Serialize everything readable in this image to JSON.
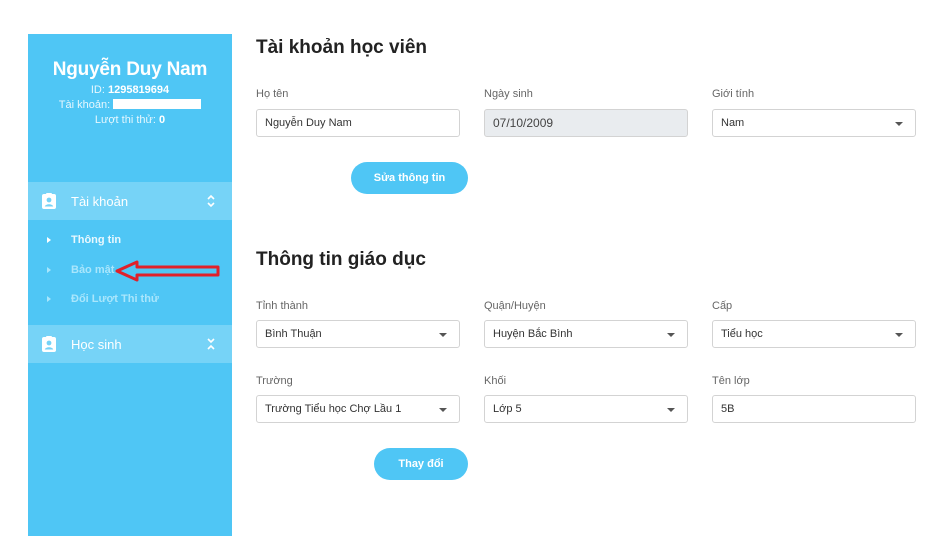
{
  "profile": {
    "name": "Nguyễn Duy Nam",
    "id_label": "ID:",
    "id_value": "1295819694",
    "account_label": "Tài khoản:",
    "attempts_label": "Lượt thi thử:",
    "attempts_value": "0"
  },
  "sidebar": {
    "account_menu": {
      "label": "Tài khoản",
      "icon": "user-badge-icon",
      "items": [
        {
          "label": "Thông tin"
        },
        {
          "label": "Bảo mật"
        },
        {
          "label": "Đổi Lượt Thi thử"
        }
      ]
    },
    "student_menu": {
      "label": "Học sinh",
      "icon": "user-badge-icon"
    }
  },
  "account_section": {
    "title": "Tài khoản học viên",
    "fullname": {
      "label": "Họ tên",
      "value": "Nguyễn Duy Nam"
    },
    "birthday": {
      "label": "Ngày sinh",
      "value": "07/10/2009"
    },
    "gender": {
      "label": "Giới tính",
      "value": "Nam"
    },
    "edit_button": "Sửa thông tin"
  },
  "education_section": {
    "title": "Thông tin giáo dục",
    "province": {
      "label": "Tỉnh thành",
      "value": "Bình Thuận"
    },
    "district": {
      "label": "Quận/Huyện",
      "value": "Huyện Bắc Bình"
    },
    "level": {
      "label": "Cấp",
      "value": "Tiểu học"
    },
    "school": {
      "label": "Trường",
      "value": "Trường Tiểu học Chợ Lầu 1"
    },
    "grade": {
      "label": "Khối",
      "value": "Lớp 5"
    },
    "class_name": {
      "label": "Tên lớp",
      "value": "5B"
    },
    "change_button": "Thay đổi"
  },
  "colors": {
    "accent": "#4fc6f5",
    "menu_head": "#76d3f7",
    "annotation_arrow": "#e0202a"
  }
}
